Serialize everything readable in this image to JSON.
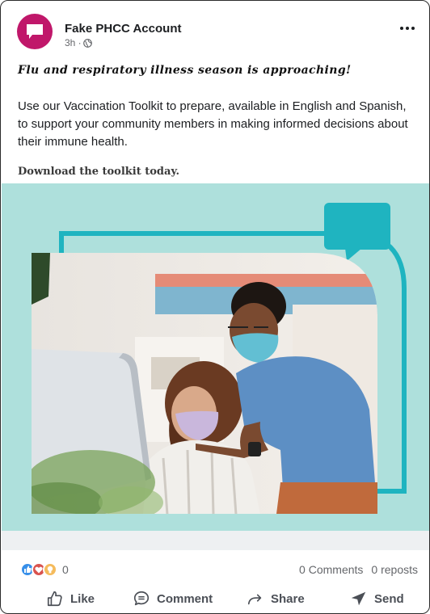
{
  "post": {
    "account_name": "Fake PHCC Account",
    "time": "3h ·",
    "headline": "Flu and respiratory illness season is approaching!",
    "body": "Use our Vaccination Toolkit to prepare, available in English and Spanish, to support your community members in making informed decisions about their immune health.",
    "cta": "Download the toolkit today."
  },
  "engagement": {
    "reaction_count": "0",
    "comments": "0 Comments",
    "reposts": "0 reposts"
  },
  "actions": {
    "like": "Like",
    "comment": "Comment",
    "share": "Share",
    "send": "Send"
  },
  "colors": {
    "avatar": "#c0176a",
    "media_bg": "#aee0dc",
    "frame_teal": "#1fb4c0",
    "like_blue": "#378fe9",
    "celebrate_red": "#d9534f",
    "insight_yellow": "#f5bb5c"
  },
  "icons": [
    "chat-bubble-icon",
    "globe-icon",
    "more-icon",
    "like-icon",
    "comment-icon",
    "share-icon",
    "send-icon"
  ]
}
